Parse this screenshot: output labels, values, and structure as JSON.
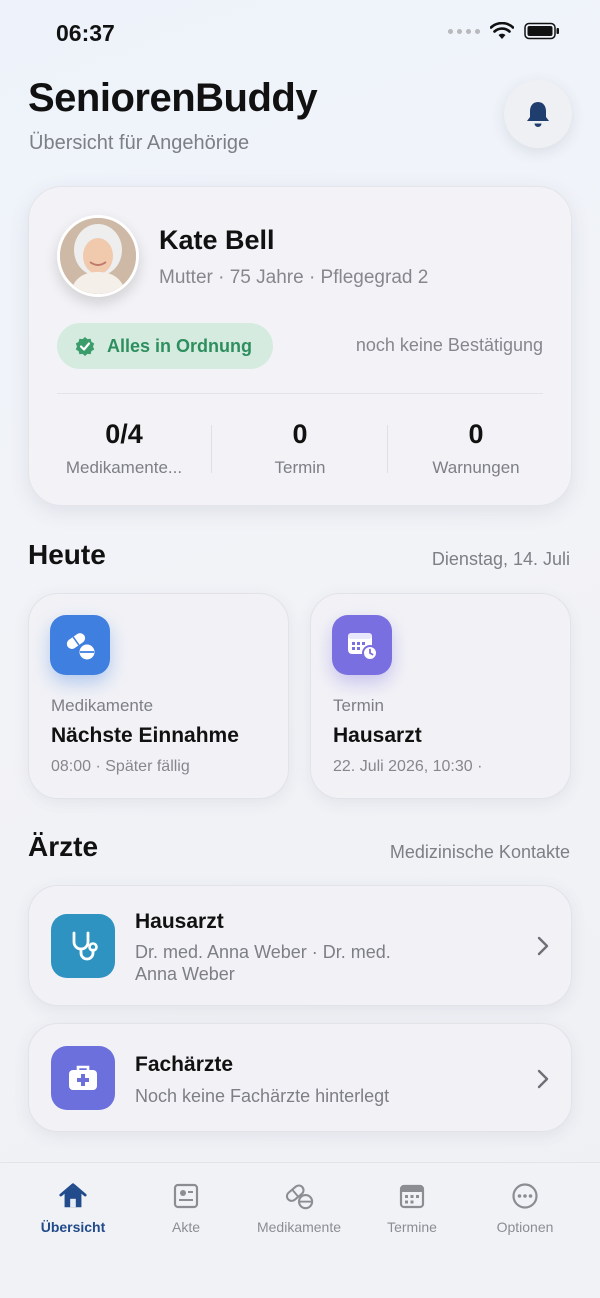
{
  "status_bar": {
    "time": "06:37"
  },
  "header": {
    "title": "SeniorenBuddy",
    "subtitle": "Übersicht für Angehörige"
  },
  "profile": {
    "name": "Kate Bell",
    "meta": "Mutter · 75 Jahre · Pflegegrad 2",
    "status_label": "Alles in Ordnung",
    "confirmation": "noch keine Bestätigung",
    "stats": [
      {
        "value": "0/4",
        "label": "Medikamente..."
      },
      {
        "value": "0",
        "label": "Termin"
      },
      {
        "value": "0",
        "label": "Warnungen"
      }
    ]
  },
  "today": {
    "title": "Heute",
    "date": "Dienstag, 14. Juli",
    "cards": [
      {
        "kicker": "Medikamente",
        "title": "Nächste Einnahme",
        "sub": "08:00 · Später fällig",
        "icon": "pills-icon",
        "color": "#3f7fe0"
      },
      {
        "kicker": "Termin",
        "title": "Hausarzt",
        "sub": "22. Juli 2026, 10:30 ·",
        "icon": "calendar-clock-icon",
        "color": "#7a6fe0"
      }
    ]
  },
  "doctors": {
    "title": "Ärzte",
    "aside": "Medizinische Kontakte",
    "items": [
      {
        "title": "Hausarzt",
        "sub": "Dr. med. Anna Weber · Dr. med. Anna Weber",
        "icon": "stethoscope-icon",
        "color": "#2f93c2"
      },
      {
        "title": "Fachärzte",
        "sub": "Noch keine Fachärzte hinterlegt",
        "icon": "medical-kit-icon",
        "color": "#6c70dd"
      }
    ]
  },
  "tabs": [
    {
      "label": "Übersicht",
      "icon": "home-icon",
      "active": true
    },
    {
      "label": "Akte",
      "icon": "record-icon",
      "active": false
    },
    {
      "label": "Medikamente",
      "icon": "pills-icon",
      "active": false
    },
    {
      "label": "Termine",
      "icon": "calendar-icon",
      "active": false
    },
    {
      "label": "Optionen",
      "icon": "more-icon",
      "active": false
    }
  ],
  "colors": {
    "accent": "#224b8b",
    "success": "#2e8f5e",
    "success_bg": "#d5ebe0"
  }
}
